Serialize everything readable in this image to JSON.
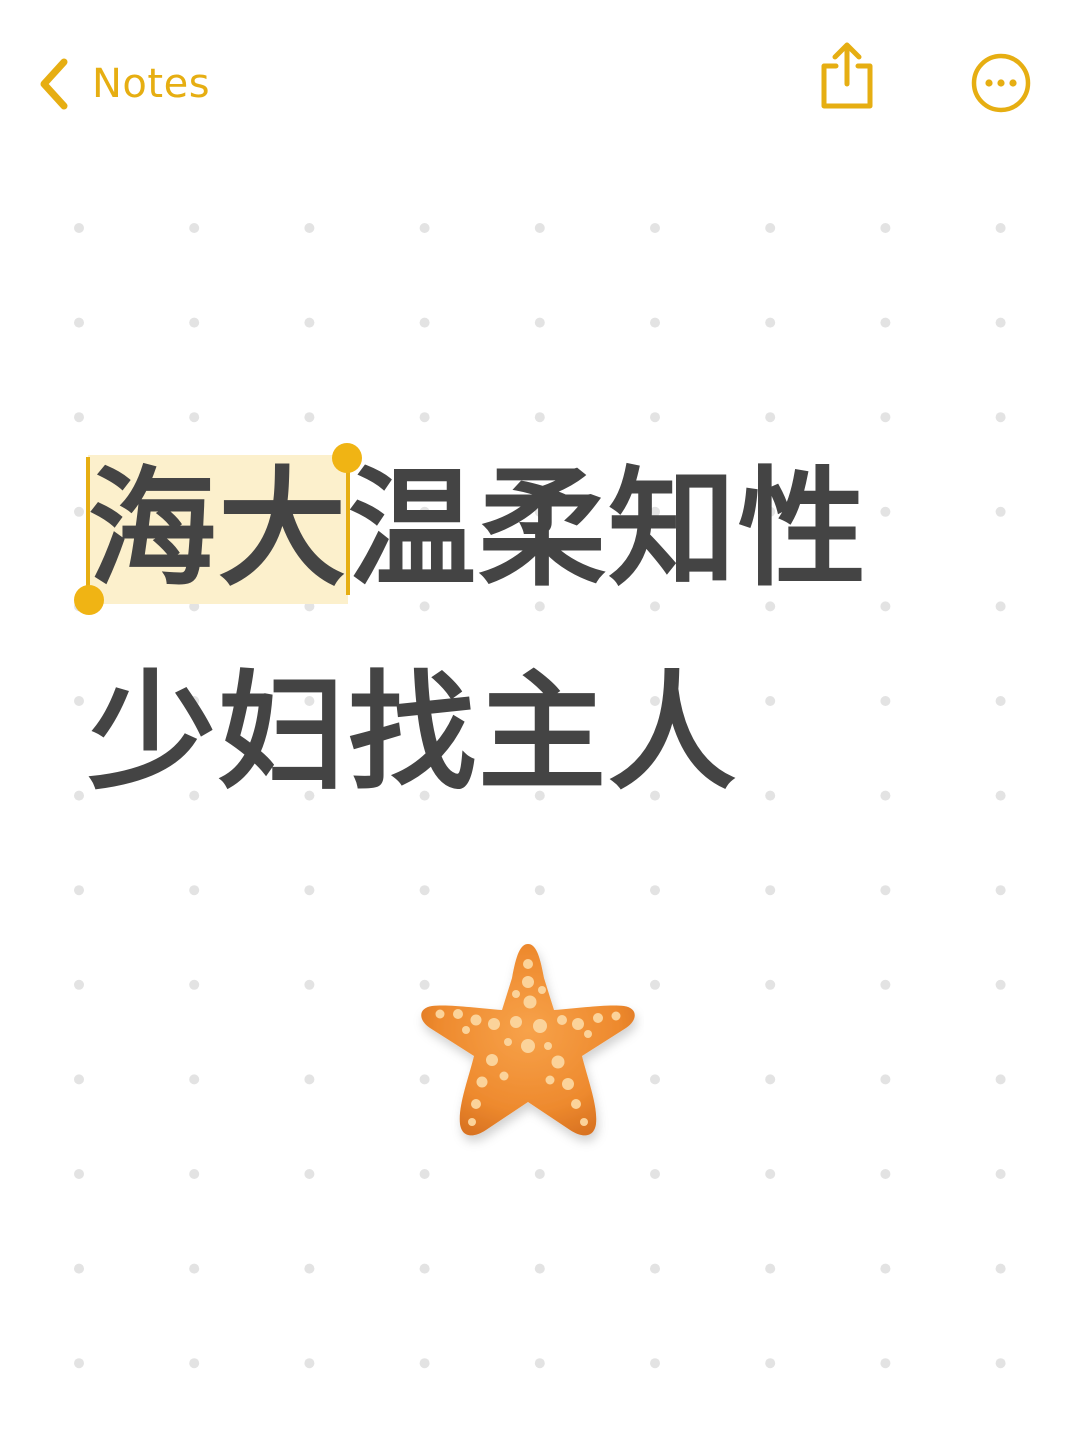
{
  "header": {
    "back_label": "Notes",
    "accent_color": "#e6ae12",
    "back_icon": "chevron-left-icon",
    "share_icon": "share-icon",
    "more_icon": "ellipsis-circle-icon"
  },
  "note": {
    "line1_selected": "海大",
    "line1_rest": "温柔知性",
    "line2": "少妇找主人",
    "text_color": "#444444",
    "selection_color": "#fcf0cc",
    "emoji_icon": "starfish-icon"
  },
  "background": {
    "pattern": "dot-grid",
    "dot_color": "#e3e3e3"
  }
}
